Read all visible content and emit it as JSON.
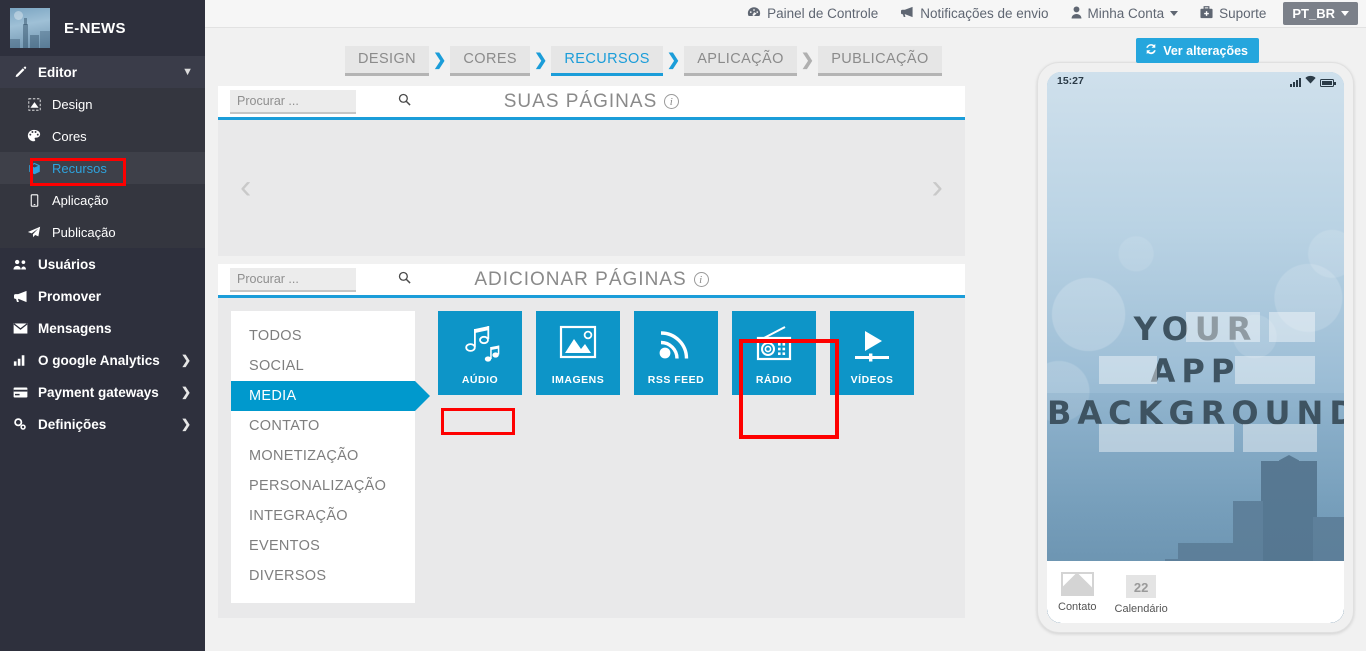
{
  "app": {
    "brand_name": "E-NEWS",
    "logo_icon": "city-skyline-thumbnail"
  },
  "sidebar": {
    "editor": {
      "label": "Editor",
      "icon": "pencil-icon",
      "chevron": "chevron-down-icon"
    },
    "editor_items": [
      {
        "label": "Design",
        "icon": "design-frame-icon",
        "active": false
      },
      {
        "label": "Cores",
        "icon": "palette-icon",
        "active": false
      },
      {
        "label": "Recursos",
        "icon": "cube-icon",
        "active": true
      },
      {
        "label": "Aplicação",
        "icon": "mobile-icon",
        "active": false
      },
      {
        "label": "Publicação",
        "icon": "paper-plane-icon",
        "active": false
      }
    ],
    "items": [
      {
        "label": "Usuários",
        "icon": "users-icon",
        "has_submenu": false
      },
      {
        "label": "Promover",
        "icon": "megaphone-icon",
        "has_submenu": false
      },
      {
        "label": "Mensagens",
        "icon": "envelope-icon",
        "has_submenu": false
      },
      {
        "label": "O google Analytics",
        "icon": "bar-chart-icon",
        "has_submenu": true
      },
      {
        "label": "Payment gateways",
        "icon": "credit-card-icon",
        "has_submenu": true
      },
      {
        "label": "Definições",
        "icon": "gears-icon",
        "has_submenu": true
      }
    ]
  },
  "topbar": {
    "items": [
      {
        "label": "Painel de Controle",
        "icon": "dashboard-icon",
        "caret": false
      },
      {
        "label": "Notificações de envio",
        "icon": "megaphone-icon",
        "caret": false
      },
      {
        "label": "Minha Conta",
        "icon": "user-icon",
        "caret": true
      },
      {
        "label": "Suporte",
        "icon": "briefcase-medical-icon",
        "caret": false
      }
    ],
    "language": "PT_BR"
  },
  "toolbar": {
    "view_changes_label": "Ver alterações",
    "view_changes_icon": "refresh-icon"
  },
  "breadcrumb": {
    "items": [
      {
        "label": "DESIGN",
        "active": false
      },
      {
        "label": "CORES",
        "active": false
      },
      {
        "label": "RECURSOS",
        "active": true
      },
      {
        "label": "APLICAÇÃO",
        "active": false
      },
      {
        "label": "PUBLICAÇÃO",
        "active": false
      }
    ],
    "separator": "chevron-right-icon"
  },
  "your_pages": {
    "title": "SUAS PÁGINAS",
    "info_icon": "info-circle-icon",
    "search_placeholder": "Procurar ...",
    "search_value": "",
    "search_icon": "search-icon",
    "prev_icon": "chevron-left-icon",
    "next_icon": "chevron-right-icon"
  },
  "add_pages": {
    "title": "ADICIONAR PÁGINAS",
    "info_icon": "info-circle-icon",
    "search_placeholder": "Procurar ...",
    "search_value": "",
    "search_icon": "search-icon",
    "categories": [
      {
        "label": "TODOS",
        "active": false
      },
      {
        "label": "SOCIAL",
        "active": false
      },
      {
        "label": "MEDIA",
        "active": true
      },
      {
        "label": "CONTATO",
        "active": false
      },
      {
        "label": "MONETIZAÇÃO",
        "active": false
      },
      {
        "label": "PERSONALIZAÇÃO",
        "active": false
      },
      {
        "label": "INTEGRAÇÃO",
        "active": false
      },
      {
        "label": "EVENTOS",
        "active": false
      },
      {
        "label": "DIVERSOS",
        "active": false
      }
    ],
    "tiles": [
      {
        "label": "AÚDIO",
        "icon": "music-notes-icon",
        "selected": false
      },
      {
        "label": "IMAGENS",
        "icon": "photo-icon",
        "selected": true
      },
      {
        "label": "RSS FEED",
        "icon": "rss-icon",
        "selected": false
      },
      {
        "label": "RÁDIO",
        "icon": "radio-icon",
        "selected": false
      },
      {
        "label": "VÍDEOS",
        "icon": "play-video-icon",
        "selected": false
      }
    ]
  },
  "phone_preview": {
    "status_time": "15:27",
    "signal_icon": "signal-bars-icon",
    "wifi_icon": "wifi-icon",
    "battery_icon": "battery-full-icon",
    "background_text_lines": [
      "YOUR",
      "APP",
      "BACKGROUND"
    ],
    "tabs": [
      {
        "label": "Contato",
        "icon": "envelope-icon"
      },
      {
        "label": "Calendário",
        "icon": "calendar-icon",
        "badge": "22"
      }
    ]
  },
  "colors": {
    "accent": "#1b9dd9",
    "tile": "#0d95c8",
    "category_active": "#0099cd",
    "sidebar": "#2e303d",
    "highlight": "#fe0000"
  }
}
